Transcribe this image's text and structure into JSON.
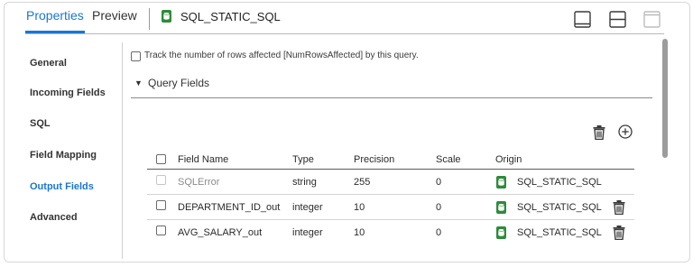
{
  "header": {
    "tabs": [
      {
        "label": "Properties",
        "active": true
      },
      {
        "label": "Preview",
        "active": false
      }
    ],
    "transformation_title": "SQL_STATIC_SQL",
    "accent_color": "#1976d2",
    "icons": {
      "transformation": "sql-transformation-icon",
      "layout_buttons": [
        "panel-bottom-icon",
        "split-horizontal-icon",
        "panel-top-icon"
      ]
    }
  },
  "sidebar": {
    "items": [
      {
        "label": "General",
        "active": false
      },
      {
        "label": "Incoming Fields",
        "active": false
      },
      {
        "label": "SQL",
        "active": false
      },
      {
        "label": "Field Mapping",
        "active": false
      },
      {
        "label": "Output Fields",
        "active": true
      },
      {
        "label": "Advanced",
        "active": false
      }
    ]
  },
  "content": {
    "track_rows_label": "Track the number of rows affected [NumRowsAffected] by this query.",
    "track_rows_checked": false,
    "section_title": "Query Fields",
    "section_expanded": true,
    "toolbar_icons": [
      "trash-icon",
      "add-circle-icon"
    ]
  },
  "table": {
    "columns": [
      "Field Name",
      "Type",
      "Precision",
      "Scale",
      "Origin"
    ],
    "rows": [
      {
        "field_name": "SQLError",
        "type": "string",
        "precision": "255",
        "scale": "0",
        "origin": "SQL_STATIC_SQL",
        "disabled": true,
        "deletable": false
      },
      {
        "field_name": "DEPARTMENT_ID_out",
        "type": "integer",
        "precision": "10",
        "scale": "0",
        "origin": "SQL_STATIC_SQL",
        "disabled": false,
        "deletable": true
      },
      {
        "field_name": "AVG_SALARY_out",
        "type": "integer",
        "precision": "10",
        "scale": "0",
        "origin": "SQL_STATIC_SQL",
        "disabled": false,
        "deletable": true
      }
    ],
    "origin_icon_color": "#2e8b3a"
  }
}
